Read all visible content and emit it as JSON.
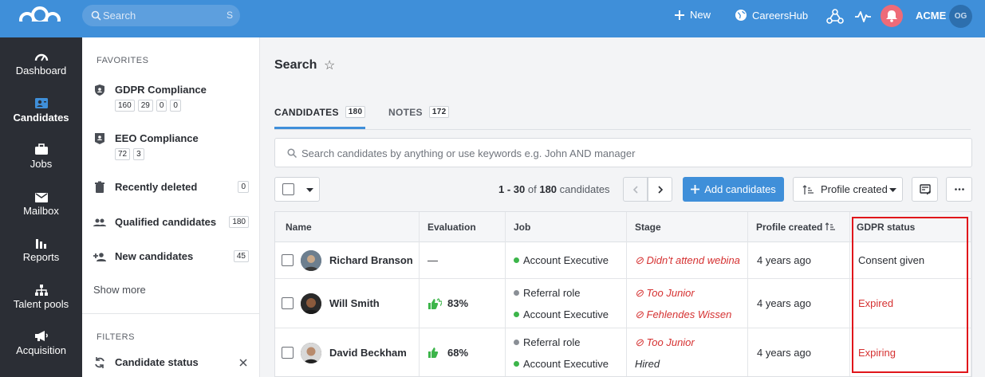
{
  "topbar": {
    "search_placeholder": "Search",
    "search_shortcut": "S",
    "new_label": "New",
    "careershub_label": "CareersHub",
    "account_label": "ACME",
    "avatar_initials": "OG",
    "bell_color": "#ee6b78",
    "brand_color": "#3f8fd9"
  },
  "nav": {
    "items": [
      {
        "label": "Dashboard",
        "icon": "speedometer-icon"
      },
      {
        "label": "Candidates",
        "icon": "contact-card-icon"
      },
      {
        "label": "Jobs",
        "icon": "briefcase-icon"
      },
      {
        "label": "Mailbox",
        "icon": "envelope-icon"
      },
      {
        "label": "Reports",
        "icon": "bar-chart-icon"
      },
      {
        "label": "Talent pools",
        "icon": "hierarchy-icon"
      },
      {
        "label": "Acquisition",
        "icon": "megaphone-icon"
      }
    ]
  },
  "favorites": {
    "title": "FAVORITES",
    "items": [
      {
        "label": "GDPR Compliance",
        "badges": [
          "160",
          "29",
          "0",
          "0"
        ]
      },
      {
        "label": "EEO Compliance",
        "badges": [
          "72",
          "3"
        ]
      },
      {
        "label": "Recently deleted",
        "count": "0"
      },
      {
        "label": "Qualified candidates",
        "count": "180"
      },
      {
        "label": "New candidates",
        "count": "45"
      }
    ],
    "show_more": "Show more",
    "filters_title": "FILTERS",
    "filter_item": "Candidate status"
  },
  "main": {
    "title": "Search",
    "tabs": [
      {
        "label": "CANDIDATES",
        "count": "180"
      },
      {
        "label": "NOTES",
        "count": "172"
      }
    ],
    "search_placeholder": "Search candidates by anything or use keywords e.g. John AND manager",
    "range": "1 - 30",
    "of": "of",
    "total": "180",
    "candidates_word": "candidates",
    "add_button": "Add candidates",
    "sort_label": "Profile created"
  },
  "table": {
    "headers": {
      "name": "Name",
      "evaluation": "Evaluation",
      "job": "Job",
      "stage": "Stage",
      "profile_created": "Profile created",
      "gdpr": "GDPR status"
    },
    "rows": [
      {
        "name": "Richard Branson",
        "evaluation": "—",
        "jobs": [
          {
            "label": "Account Executive",
            "color": "#3cb54a"
          }
        ],
        "stages": [
          {
            "label": "Didn't attend webina",
            "type": "disqualified"
          }
        ],
        "profile_created": "4 years ago",
        "gdpr": "Consent given"
      },
      {
        "name": "Will Smith",
        "evaluation": "83%",
        "jobs": [
          {
            "label": "Referral role",
            "color": "#8a8f96"
          },
          {
            "label": "Account Executive",
            "color": "#3cb54a"
          }
        ],
        "stages": [
          {
            "label": "Too Junior",
            "type": "disqualified"
          },
          {
            "label": "Fehlendes Wissen",
            "type": "disqualified"
          }
        ],
        "profile_created": "4 years ago",
        "gdpr": "Expired"
      },
      {
        "name": "David Beckham",
        "evaluation": "68%",
        "jobs": [
          {
            "label": "Referral role",
            "color": "#8a8f96"
          },
          {
            "label": "Account Executive",
            "color": "#3cb54a"
          }
        ],
        "stages": [
          {
            "label": "Too Junior",
            "type": "disqualified"
          },
          {
            "label": "Hired",
            "type": "plain"
          }
        ],
        "profile_created": "4 years ago",
        "gdpr": "Expiring"
      }
    ]
  }
}
